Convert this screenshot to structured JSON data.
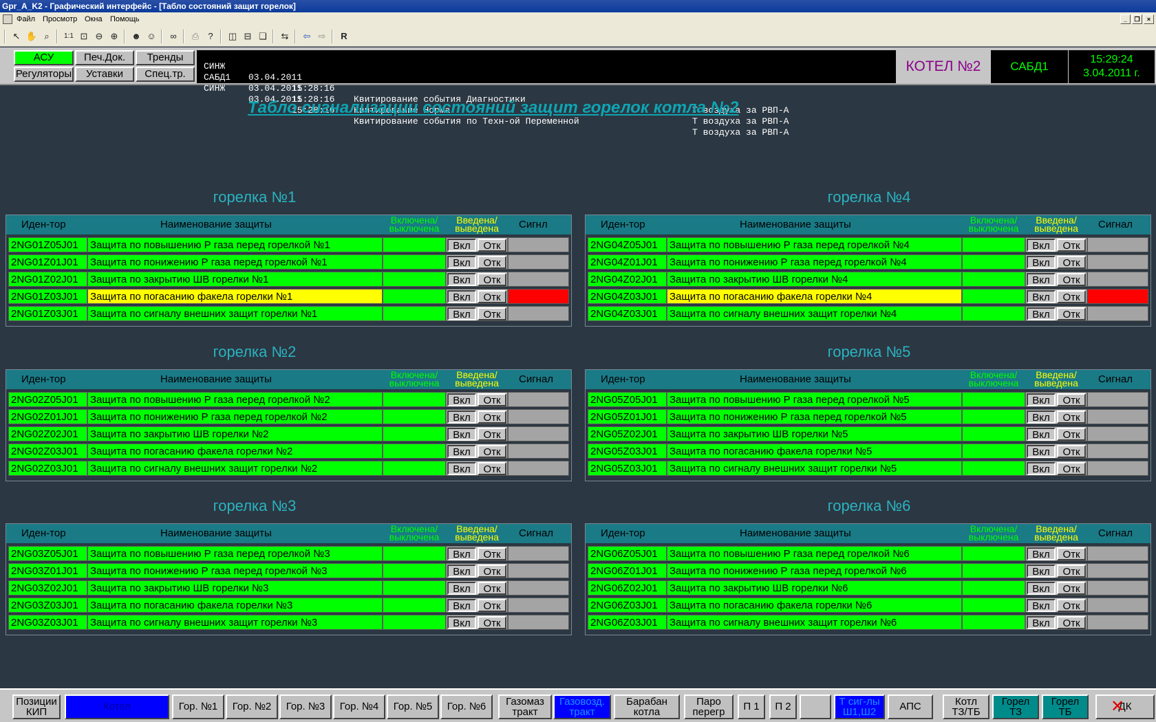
{
  "window": {
    "title": "Gpr_A_K2 - Графический интерфейс - [Табло состояний защит горелок]"
  },
  "menu": [
    "Файл",
    "Просмотр",
    "Окна",
    "Помощь"
  ],
  "toolbar": {
    "r_label": "R"
  },
  "nav": {
    "asu": "АСУ",
    "pech": "Печ.Док.",
    "trendy": "Тренды",
    "regulatory": "Регуляторы",
    "ustavki": "Уставки",
    "spectr": "Спец.тр."
  },
  "events": [
    {
      "src": "СИНЖ",
      "date": "03.04.2011",
      "time": "15:28:16",
      "text": "Квитирование события Диагностики",
      "param": "Т воздуха за РВП-А"
    },
    {
      "src": "САБД1",
      "date": "03.04.2011",
      "time": "15:28:16",
      "text": "Квитирование Норма",
      "param": "Т воздуха за РВП-А"
    },
    {
      "src": "СИНЖ",
      "date": "03.04.2011",
      "time": "15:28:16",
      "text": "Квитирование события по Техн-ой Переменной",
      "param": "Т воздуха за РВП-А"
    }
  ],
  "kotel": "КОТЕЛ №2",
  "sabd": "САБД1",
  "clock": {
    "time": "15:29:24",
    "date": "3.04.2011 г."
  },
  "page_title": "Табло сигнализации состояний защит горелок котла №2",
  "table_header": {
    "id": "Иден-тор",
    "name": "Наименование защиты",
    "on1": "Включена/",
    "on2": "выключена",
    "in1": "Введена/",
    "in2": "выведена",
    "signal": "Сигнал",
    "signal_b1": "Сигнл"
  },
  "buttons": {
    "vkl": "Вкл",
    "otk": "Отк"
  },
  "colors": {
    "green": "#00ff00",
    "yellow": "#ffff00",
    "red": "#ff0000",
    "gray": "#a4a4a4",
    "header": "#1a7a86",
    "title": "#0ea5b3"
  },
  "burners": [
    {
      "title": "горелка №1",
      "rows": [
        {
          "id": "2NG01Z05J01",
          "name": "Защита по повышению Р газа перед горелкой №1",
          "alarm": false
        },
        {
          "id": "2NG01Z01J01",
          "name": "Защита по понижению Р газа перед горелкой №1",
          "alarm": false
        },
        {
          "id": "2NG01Z02J01",
          "name": "Защита по закрытию ШВ горелки №1",
          "alarm": false
        },
        {
          "id": "2NG01Z03J01",
          "name": "Защита по погасанию факела горелки №1",
          "alarm": true
        },
        {
          "id": "2NG01Z03J01",
          "name": "Защита по сигналу внешних защит горелки №1",
          "alarm": false
        }
      ]
    },
    {
      "title": "горелка №2",
      "rows": [
        {
          "id": "2NG02Z05J01",
          "name": "Защита по повышению Р газа перед горелкой №2",
          "alarm": false
        },
        {
          "id": "2NG02Z01J01",
          "name": "Защита по понижению Р газа перед горелкой №2",
          "alarm": false
        },
        {
          "id": "2NG02Z02J01",
          "name": "Защита по закрытию ШВ горелки №2",
          "alarm": false
        },
        {
          "id": "2NG02Z03J01",
          "name": "Защита по погасанию факела горелки №2",
          "alarm": false
        },
        {
          "id": "2NG02Z03J01",
          "name": "Защита по сигналу внешних защит горелки №2",
          "alarm": false
        }
      ]
    },
    {
      "title": "горелка №3",
      "rows": [
        {
          "id": "2NG03Z05J01",
          "name": "Защита по повышению Р газа перед горелкой №3",
          "alarm": false
        },
        {
          "id": "2NG03Z01J01",
          "name": "Защита по понижению Р газа перед горелкой №3",
          "alarm": false
        },
        {
          "id": "2NG03Z02J01",
          "name": "Защита по закрытию ШВ горелки №3",
          "alarm": false
        },
        {
          "id": "2NG03Z03J01",
          "name": "Защита по погасанию факела горелки №3",
          "alarm": false
        },
        {
          "id": "2NG03Z03J01",
          "name": "Защита по сигналу внешних защит горелки №3",
          "alarm": false
        }
      ]
    },
    {
      "title": "горелка №4",
      "rows": [
        {
          "id": "2NG04Z05J01",
          "name": "Защита по повышению Р газа перед горелкой №4",
          "alarm": false
        },
        {
          "id": "2NG04Z01J01",
          "name": "Защита по понижению Р газа перед горелкой №4",
          "alarm": false
        },
        {
          "id": "2NG04Z02J01",
          "name": "Защита по закрытию ШВ горелки №4",
          "alarm": false
        },
        {
          "id": "2NG04Z03J01",
          "name": "Защита по погасанию факела горелки №4",
          "alarm": true
        },
        {
          "id": "2NG04Z03J01",
          "name": "Защита по сигналу внешних защит горелки №4",
          "alarm": false
        }
      ]
    },
    {
      "title": "горелка №5",
      "rows": [
        {
          "id": "2NG05Z05J01",
          "name": "Защита по повышению Р газа перед горелкой №5",
          "alarm": false
        },
        {
          "id": "2NG05Z01J01",
          "name": "Защита по понижению Р газа перед горелкой №5",
          "alarm": false
        },
        {
          "id": "2NG05Z02J01",
          "name": "Защита по закрытию ШВ горелки №5",
          "alarm": false
        },
        {
          "id": "2NG05Z03J01",
          "name": "Защита по погасанию факела горелки №5",
          "alarm": false
        },
        {
          "id": "2NG05Z03J01",
          "name": "Защита по сигналу внешних защит горелки №5",
          "alarm": false
        }
      ]
    },
    {
      "title": "горелка №6",
      "rows": [
        {
          "id": "2NG06Z05J01",
          "name": "Защита по повышению Р газа перед горелкой №6",
          "alarm": false
        },
        {
          "id": "2NG06Z01J01",
          "name": "Защита по понижению Р газа перед горелкой №6",
          "alarm": false
        },
        {
          "id": "2NG06Z02J01",
          "name": "Защита по закрытию ШВ горелки №6",
          "alarm": false
        },
        {
          "id": "2NG06Z03J01",
          "name": "Защита по погасанию факела горелки №6",
          "alarm": false
        },
        {
          "id": "2NG06Z03J01",
          "name": "Защита по сигналу внешних защит горелки №6",
          "alarm": false
        }
      ]
    }
  ],
  "bottom": {
    "pozicii1": "Позиции",
    "pozicii2": "КИП",
    "kotel": "Котел",
    "gor1": "Гор. №1",
    "gor2": "Гор. №2",
    "gor3": "Гор. №3",
    "gor4": "Гор. №4",
    "gor5": "Гор. №5",
    "gor6": "Гор. №6",
    "gazomaz1": "Газомаз",
    "gazomaz2": "тракт",
    "gazovozd1": "Газовозд.",
    "gazovozd2": "тракт",
    "baraban1": "Барабан",
    "baraban2": "котла",
    "paro1": "Паро",
    "paro2": "перегр",
    "p1": "П 1",
    "p2": "П 2",
    "tsig1": "Т сиг-лы",
    "tsig2": "Ш1,Ш2",
    "aps": "АПС",
    "kotl1": "Котл",
    "kotl2": "ТЗ/ТБ",
    "gorelTZ1": "Горел",
    "gorelTZ2": "ТЗ",
    "gorelTB1": "Горел",
    "gorelTB2": "ТБ",
    "dk": "ДК"
  }
}
